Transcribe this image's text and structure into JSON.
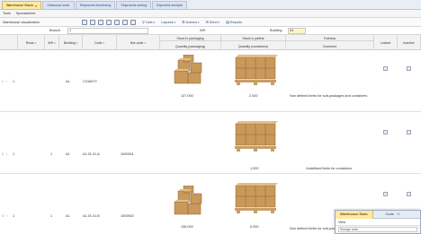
{
  "tabs": [
    {
      "label": "Warehouse Stock",
      "active": true,
      "closable": true
    },
    {
      "label": "Outbound order",
      "active": false,
      "closable": false
    },
    {
      "label": "Shipments Monitoring",
      "active": false,
      "closable": false
    },
    {
      "label": "Shipments sorting",
      "active": false,
      "closable": false
    },
    {
      "label": "Expected receipts",
      "active": false,
      "closable": false
    }
  ],
  "menu": [
    "Tools",
    "Spreadsheet"
  ],
  "toolbar": {
    "title": "Warehouse visualization",
    "icons": [
      "dropdown-icon",
      "table-icon",
      "export-icon",
      "print-icon",
      "calendar-icon",
      "refresh-icon",
      "filter-icon"
    ],
    "items": [
      {
        "label": "Lists",
        "icon": "funnel-icon"
      },
      {
        "label": "Layouts",
        "icon": "layout-icon"
      },
      {
        "label": "Actions",
        "icon": "gear-icon"
      },
      {
        "label": "Send",
        "icon": "send-icon"
      },
      {
        "label": "Reports",
        "icon": "report-icon"
      }
    ]
  },
  "filters": {
    "branch_label": "Branch",
    "branch_value": "1",
    "warehouse_label": "WH",
    "warehouse_value": "",
    "building_label": "Building",
    "building_value": "A1"
  },
  "columns": {
    "rows": "Rows",
    "wh": "WH",
    "building": "Building",
    "code": "Code",
    "bar_code": "Bar code",
    "stock_packaging_top": "Stock in packaging",
    "stock_packaging_bottom": "Quantity (packaging)",
    "stock_pallets_top": "Stock in pallets",
    "stock_pallets_bottom": "Quantity (containers)",
    "fullness_top": "Fullness",
    "fullness_bottom": "Comment",
    "locked": "Locked",
    "inactive": "Inactive"
  },
  "rows": [
    {
      "num": "1",
      "rows": "1",
      "wh": "",
      "building": "A1",
      "code": "COUNTY",
      "bar_code": "",
      "qty_packaging": "127.000",
      "qty_pallets": "2.000",
      "fullness": "-",
      "comment": "Non defined limits for sub-packages and containers",
      "locked": false,
      "inactive": false
    },
    {
      "num": "2",
      "rows": "1",
      "wh": "1",
      "building": "A1",
      "code": "A1.01.01.A",
      "bar_code": "1000001",
      "qty_packaging": "",
      "qty_pallets": "1.000",
      "fullness": "",
      "comment": "Undefined limits for containers",
      "locked": false,
      "inactive": false
    },
    {
      "num": "3",
      "rows": "1",
      "wh": "1",
      "building": "A1",
      "code": "A1.01.01.B",
      "bar_code": "1000002",
      "qty_packaging": "136.000",
      "qty_pallets": "6.000",
      "fullness": "",
      "comment": "Non defined limits for sub-packag",
      "locked": false,
      "inactive": false
    }
  ],
  "popup": {
    "tab_label": "Warehouse Slots",
    "col_label": "Code",
    "col_value": "00",
    "view_label": "View",
    "field_placeholder": "Storage code"
  },
  "colors": {
    "active_tab": "#fbeaa6",
    "box_brown": "#c9995b",
    "pallet_wood": "#c79f66"
  }
}
